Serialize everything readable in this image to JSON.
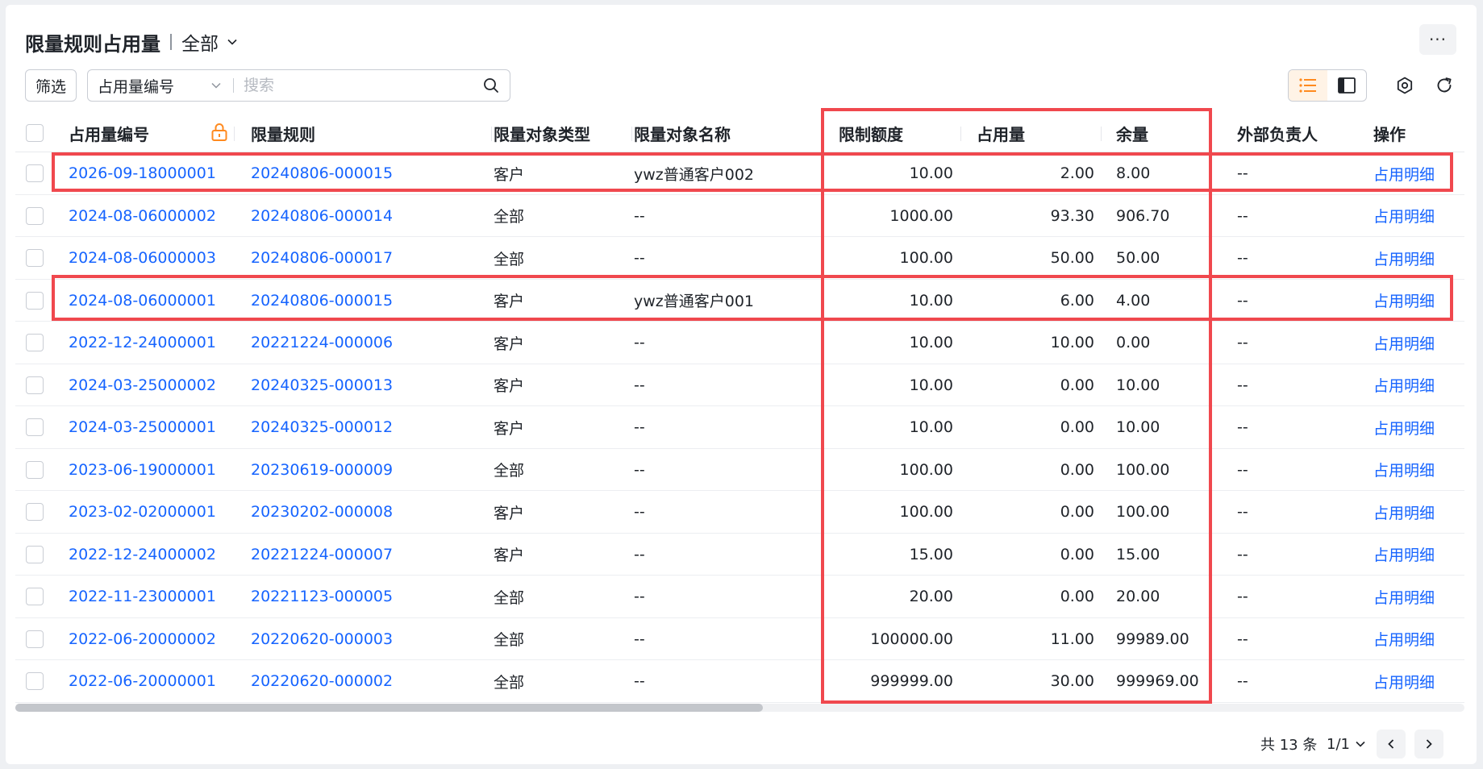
{
  "header": {
    "title": "限量规则占用量",
    "view_name": "全部",
    "more_label": "···"
  },
  "toolbar": {
    "filter_label": "筛选",
    "search_field": "占用量编号",
    "search_placeholder": "搜索"
  },
  "table": {
    "columns": [
      "占用量编号",
      "限量规则",
      "限量对象类型",
      "限量对象名称",
      "限制额度",
      "占用量",
      "余量",
      "外部负责人",
      "操作"
    ],
    "rows": [
      [
        "2026-09-18000001",
        "20240806-000015",
        "客户",
        "ywz普通客户002",
        "10.00",
        "2.00",
        "8.00",
        "--",
        "占用明细"
      ],
      [
        "2024-08-06000002",
        "20240806-000014",
        "全部",
        "--",
        "1000.00",
        "93.30",
        "906.70",
        "--",
        "占用明细"
      ],
      [
        "2024-08-06000003",
        "20240806-000017",
        "全部",
        "--",
        "100.00",
        "50.00",
        "50.00",
        "--",
        "占用明细"
      ],
      [
        "2024-08-06000001",
        "20240806-000015",
        "客户",
        "ywz普通客户001",
        "10.00",
        "6.00",
        "4.00",
        "--",
        "占用明细"
      ],
      [
        "2022-12-24000001",
        "20221224-000006",
        "客户",
        "--",
        "10.00",
        "10.00",
        "0.00",
        "--",
        "占用明细"
      ],
      [
        "2024-03-25000002",
        "20240325-000013",
        "客户",
        "--",
        "10.00",
        "0.00",
        "10.00",
        "--",
        "占用明细"
      ],
      [
        "2024-03-25000001",
        "20240325-000012",
        "客户",
        "--",
        "10.00",
        "0.00",
        "10.00",
        "--",
        "占用明细"
      ],
      [
        "2023-06-19000001",
        "20230619-000009",
        "全部",
        "--",
        "100.00",
        "0.00",
        "100.00",
        "--",
        "占用明细"
      ],
      [
        "2023-02-02000001",
        "20230202-000008",
        "客户",
        "--",
        "100.00",
        "0.00",
        "100.00",
        "--",
        "占用明细"
      ],
      [
        "2022-12-24000002",
        "20221224-000007",
        "客户",
        "--",
        "15.00",
        "0.00",
        "15.00",
        "--",
        "占用明细"
      ],
      [
        "2022-11-23000001",
        "20221123-000005",
        "全部",
        "--",
        "20.00",
        "0.00",
        "20.00",
        "--",
        "占用明细"
      ],
      [
        "2022-06-20000002",
        "20220620-000003",
        "全部",
        "--",
        "100000.00",
        "11.00",
        "99989.00",
        "--",
        "占用明细"
      ],
      [
        "2022-06-20000001",
        "20220620-000002",
        "全部",
        "--",
        "999999.00",
        "30.00",
        "999969.00",
        "--",
        "占用明细"
      ]
    ]
  },
  "pagination": {
    "total_label": "共 13 条",
    "page_label": "1/1"
  },
  "colors": {
    "link": "#1664ff",
    "highlight": "#f0484e",
    "accent": "#ff8a1f"
  }
}
